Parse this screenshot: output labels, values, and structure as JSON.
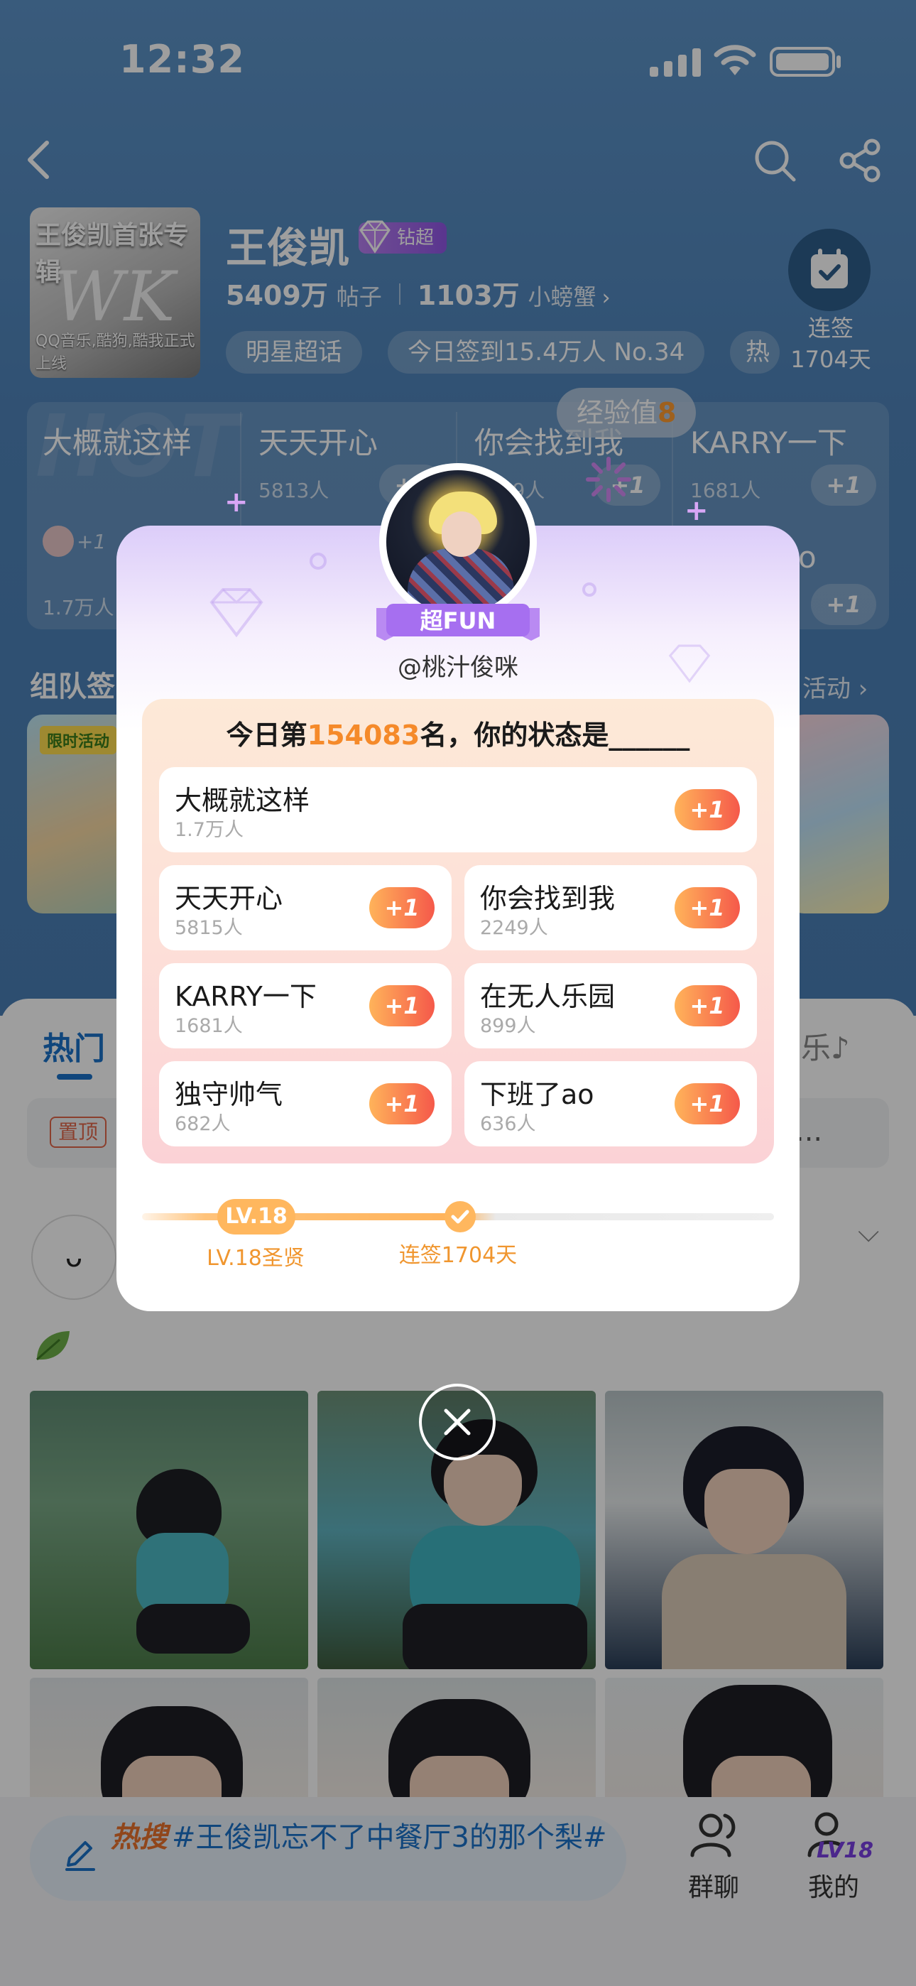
{
  "status_bar": {
    "time": "12:32"
  },
  "header": {
    "album": {
      "title": "王俊凯首张专辑",
      "logo_text": "WK",
      "subtitle": "QQ音乐,酷狗,酷我正式上线"
    },
    "star_name": "王俊凯",
    "level_badge": "钻超",
    "stats": {
      "posts_value": "5409万",
      "posts_label": "帖子",
      "fans_value": "1103万",
      "fans_label": "小螃蟹",
      "fans_chevron": "›"
    },
    "chips": [
      "明星超话",
      "今日签到15.4万人 No.34",
      "热"
    ],
    "checkin": {
      "label": "连签",
      "days": "1704天"
    }
  },
  "status_cards": {
    "cards": [
      {
        "title": "大概就这样",
        "count": "1.7万人"
      },
      {
        "title": "天天开心",
        "count": "5813人"
      },
      {
        "title": "你会找到我",
        "count": "2249人"
      },
      {
        "title": "KARRY一下",
        "count": "1681人"
      }
    ],
    "plus_label": "+1",
    "second_row_tail": "o",
    "watermark": "HOT"
  },
  "exp_badge": {
    "label": "经验值",
    "value": "8"
  },
  "team_section": {
    "title": "组队签",
    "more_link": "活动 ›",
    "card_tag": "限时活动"
  },
  "feed_tabs": {
    "hot": "热门",
    "music": "乐♪"
  },
  "pinned": {
    "tag": "置顶",
    "dots": "..."
  },
  "post": {
    "avatar_face": "ᴗ",
    "chevron": "⌵"
  },
  "bottom_bar": {
    "hot_search_tag": "热搜",
    "hot_search_text": "#王俊凯忘不了中餐厅3的那个梨#",
    "group_chat": "群聊",
    "me": "我的",
    "me_level": "LV18"
  },
  "popup": {
    "ribbon": "超FUN",
    "handle": "@桃汁俊咪",
    "title_prefix": "今日第",
    "rank": "154083",
    "title_suffix": "名，你的状态是______",
    "options": [
      {
        "title": "大概就这样",
        "count": "1.7万人"
      },
      {
        "title": "天天开心",
        "count": "5815人"
      },
      {
        "title": "你会找到我",
        "count": "2249人"
      },
      {
        "title": "KARRY一下",
        "count": "1681人"
      },
      {
        "title": "在无人乐园",
        "count": "899人"
      },
      {
        "title": "独守帅气",
        "count": "682人"
      },
      {
        "title": "下班了ao",
        "count": "636人"
      }
    ],
    "plus_label": "+1",
    "level_pill": "LV.18",
    "level_caption": "LV.18圣贤",
    "streak_caption": "连签1704天"
  },
  "colors": {
    "accent_blue": "#1b72c8",
    "rank_orange": "#f58a2a",
    "plus_gradient_start": "#ffb35a",
    "plus_gradient_end": "#f5594a",
    "popup_top_lilac": "#dccdf9"
  }
}
